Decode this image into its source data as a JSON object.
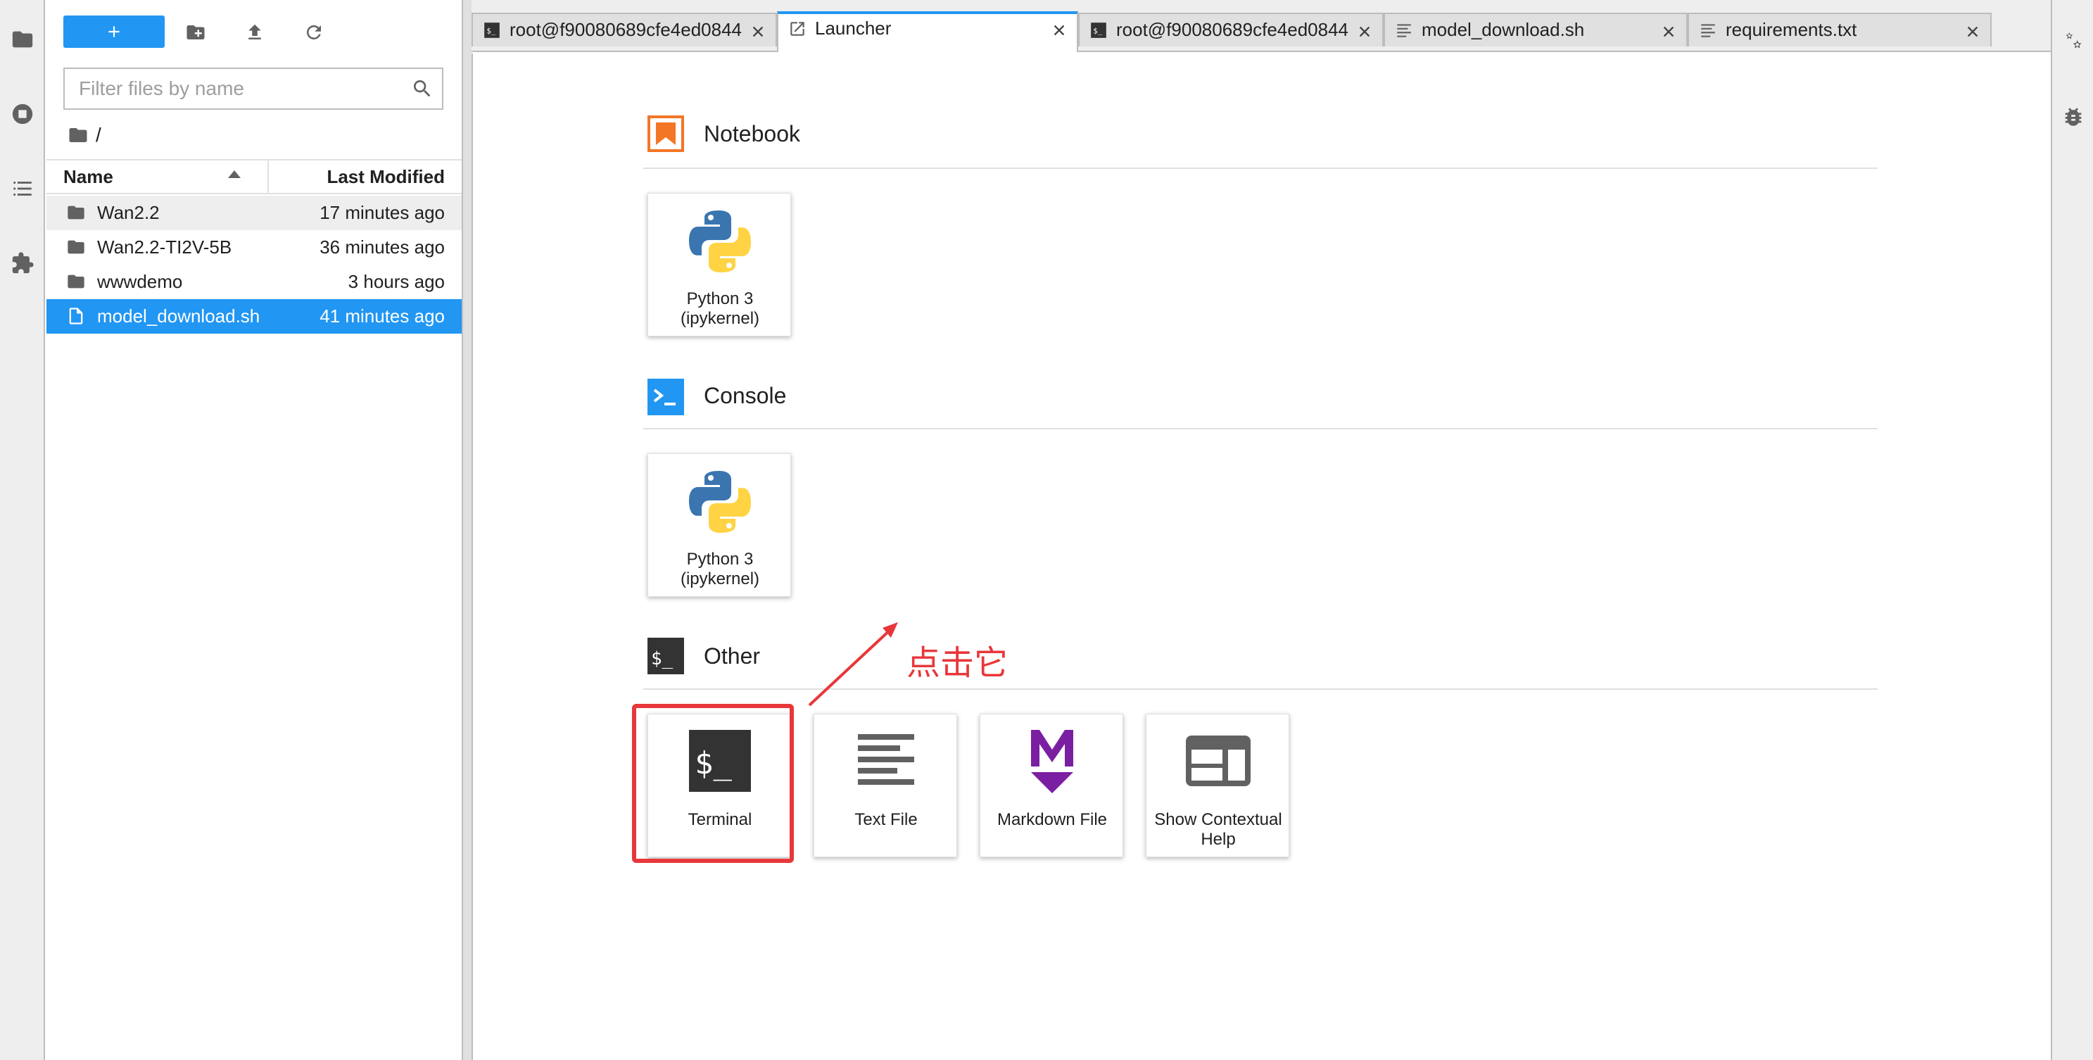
{
  "left_sidebar": {
    "icons": [
      "folder-icon",
      "running-icon",
      "table-of-contents-icon",
      "extension-icon"
    ]
  },
  "file_browser": {
    "filter_placeholder": "Filter files by name",
    "breadcrumb_path": "/",
    "columns": {
      "name": "Name",
      "modified": "Last Modified"
    },
    "files": [
      {
        "name": "Wan2.2",
        "modified": "17 minutes ago",
        "kind": "folder",
        "state": "hover"
      },
      {
        "name": "Wan2.2-TI2V-5B",
        "modified": "36 minutes ago",
        "kind": "folder",
        "state": "normal"
      },
      {
        "name": "wwwdemo",
        "modified": "3 hours ago",
        "kind": "folder",
        "state": "normal"
      },
      {
        "name": "model_download.sh",
        "modified": "41 minutes ago",
        "kind": "file",
        "state": "selected"
      }
    ]
  },
  "tabs": [
    {
      "label": "root@f90080689cfe4ed0844",
      "kind": "terminal",
      "active": false
    },
    {
      "label": "Launcher",
      "kind": "launcher",
      "active": true
    },
    {
      "label": "root@f90080689cfe4ed0844",
      "kind": "terminal",
      "active": false
    },
    {
      "label": "model_download.sh",
      "kind": "text",
      "active": false
    },
    {
      "label": "requirements.txt",
      "kind": "text",
      "active": false
    }
  ],
  "launcher": {
    "sections": [
      {
        "title": "Notebook",
        "cards": [
          {
            "label_line1": "Python 3",
            "label_line2": "(ipykernel)"
          }
        ]
      },
      {
        "title": "Console",
        "cards": [
          {
            "label_line1": "Python 3",
            "label_line2": "(ipykernel)"
          }
        ]
      },
      {
        "title": "Other",
        "cards": [
          {
            "label_line1": "Terminal",
            "label_line2": ""
          },
          {
            "label_line1": "Text File",
            "label_line2": ""
          },
          {
            "label_line1": "Markdown File",
            "label_line2": ""
          },
          {
            "label_line1": "Show Contextual",
            "label_line2": "Help"
          }
        ]
      }
    ]
  },
  "annotation": {
    "text": "点击它",
    "color": "#e8373a"
  },
  "colors": {
    "accent": "#2196f3",
    "notebook_orange": "#f37626",
    "console_blue": "#2196f3",
    "terminal_dark": "#333333",
    "markdown_purple": "#7b1fa2"
  }
}
